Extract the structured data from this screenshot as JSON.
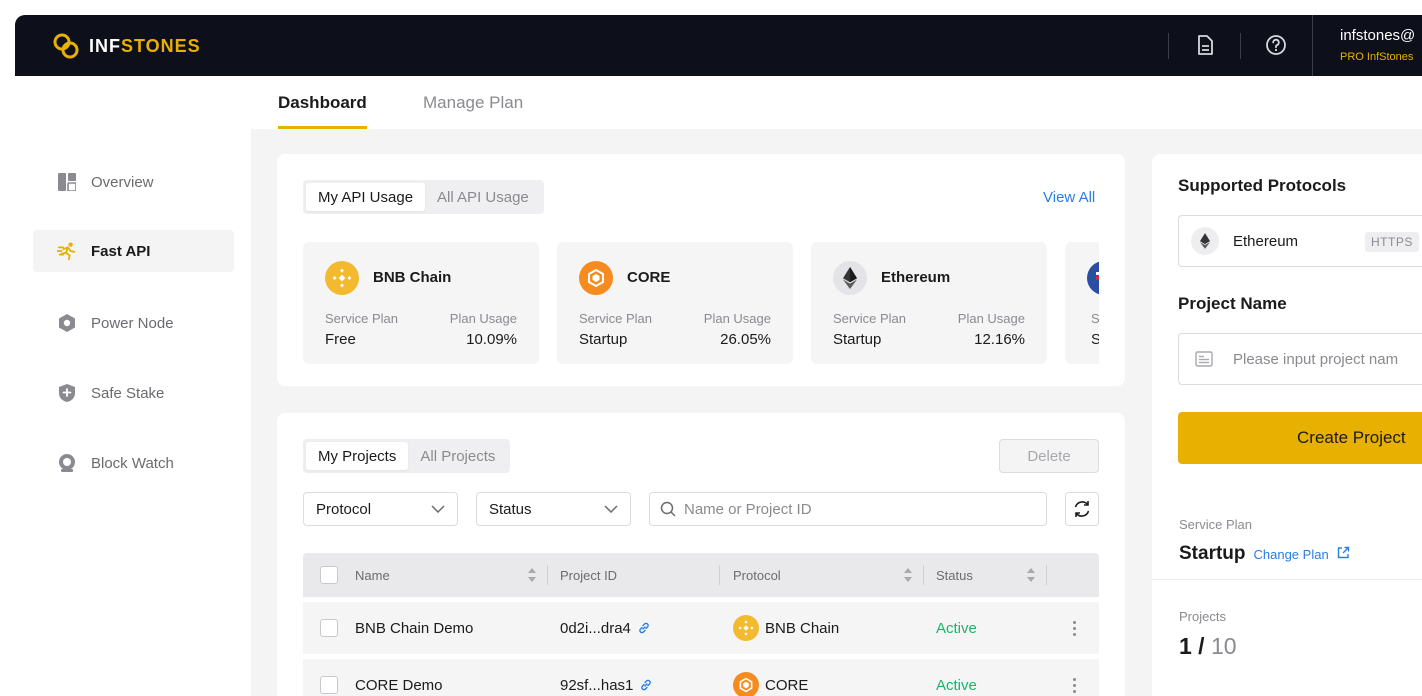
{
  "header": {
    "logo_prefix": "INF",
    "logo_suffix": "STONES",
    "user_email": "infstones@",
    "user_plan": "PRO InfStones"
  },
  "sidebar": {
    "items": [
      {
        "label": "Overview",
        "icon": "overview-icon",
        "active": false
      },
      {
        "label": "Fast API",
        "icon": "fast-api-icon",
        "active": true
      },
      {
        "label": "Power Node",
        "icon": "power-node-icon",
        "active": false
      },
      {
        "label": "Safe Stake",
        "icon": "safe-stake-icon",
        "active": false
      },
      {
        "label": "Block Watch",
        "icon": "block-watch-icon",
        "active": false
      }
    ]
  },
  "tabs": [
    {
      "label": "Dashboard",
      "active": true
    },
    {
      "label": "Manage Plan",
      "active": false
    }
  ],
  "api_usage": {
    "tabs": [
      "My API Usage",
      "All API Usage"
    ],
    "view_all": "View All",
    "cards": [
      {
        "name": "BNB Chain",
        "plan_label": "Service Plan",
        "plan": "Free",
        "usage_label": "Plan Usage",
        "usage": "10.09%"
      },
      {
        "name": "CORE",
        "plan_label": "Service Plan",
        "plan": "Startup",
        "usage_label": "Plan Usage",
        "usage": "26.05%"
      },
      {
        "name": "Ethereum",
        "plan_label": "Service Plan",
        "plan": "Startup",
        "usage_label": "Plan Usage",
        "usage": "12.16%"
      },
      {
        "plan_label_partial": "S",
        "plan_partial": "S"
      }
    ]
  },
  "projects": {
    "tabs": [
      "My Projects",
      "All Projects"
    ],
    "delete_label": "Delete",
    "filters": {
      "protocol": "Protocol",
      "status": "Status",
      "search_placeholder": "Name or Project ID"
    },
    "columns": [
      "Name",
      "Project ID",
      "Protocol",
      "Status"
    ],
    "rows": [
      {
        "name": "BNB Chain Demo",
        "project_id": "0d2i...dra4",
        "protocol": "BNB Chain",
        "status": "Active"
      },
      {
        "name": "CORE Demo",
        "project_id": "92sf...has1",
        "protocol": "CORE",
        "status": "Active"
      }
    ]
  },
  "right_panel": {
    "supported_title": "Supported Protocols",
    "protocol": "Ethereum",
    "protocol_tag": "HTTPS",
    "project_name_title": "Project Name",
    "project_name_placeholder": "Please input project nam",
    "create_label": "Create Project",
    "service_plan_label": "Service Plan",
    "service_plan": "Startup",
    "change_plan": "Change Plan",
    "projects_label": "Projects",
    "projects_used": "1 /",
    "projects_total": "10"
  },
  "colors": {
    "accent": "#e8b000",
    "link": "#2a7de1",
    "active": "#1cb46a",
    "header_bg": "#0d0f1a"
  }
}
